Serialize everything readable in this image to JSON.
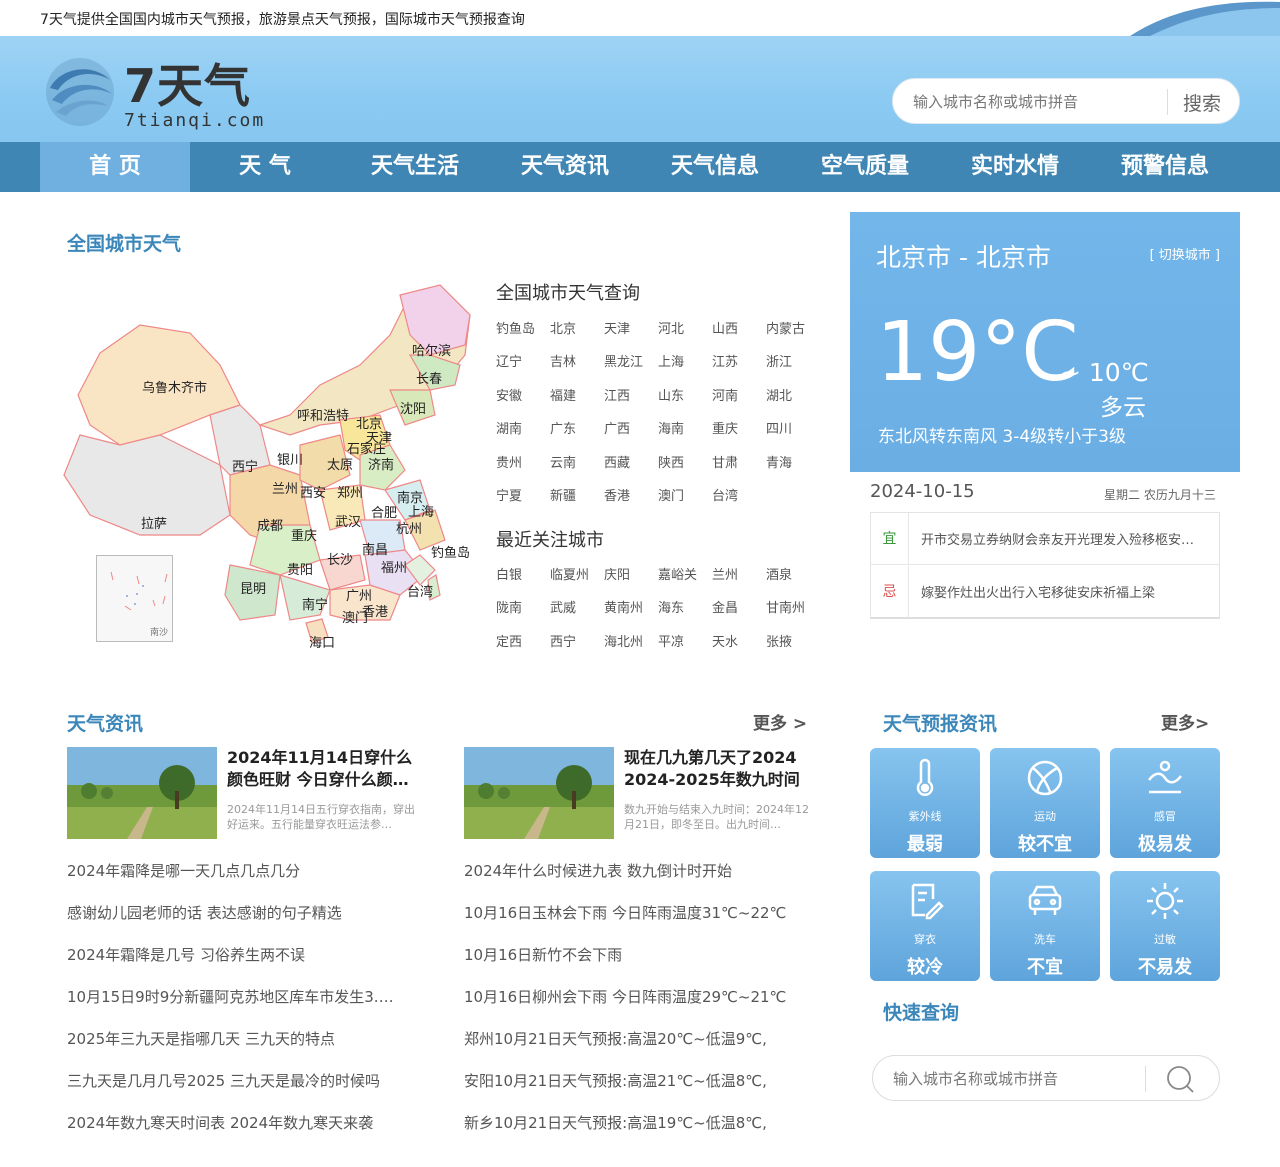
{
  "topbar": {
    "tagline": "7天气提供全国国内城市天气预报，旅游景点天气预报，国际城市天气预报查询"
  },
  "logo": {
    "wordmark": "7天气",
    "domain": "7tianqi.com"
  },
  "search_top": {
    "placeholder": "输入城市名称或城市拼音",
    "button": "搜索"
  },
  "nav": [
    "首 页",
    "天 气",
    "天气生活",
    "天气资讯",
    "天气信息",
    "空气质量",
    "实时水情",
    "预警信息"
  ],
  "national": {
    "title": "全国城市天气",
    "map_labels": [
      "乌鲁木齐市",
      "呼和浩特",
      "哈尔滨",
      "长春",
      "沈阳",
      "北京",
      "天津",
      "石家庄",
      "太原",
      "济南",
      "银川",
      "西宁",
      "兰州",
      "西安",
      "郑州",
      "南京",
      "上海",
      "合肥",
      "杭州",
      "拉萨",
      "成都",
      "重庆",
      "武汉",
      "长沙",
      "南昌",
      "福州",
      "台湾",
      "钓鱼岛",
      "贵阳",
      "昆明",
      "南宁",
      "广州",
      "香港",
      "澳门",
      "海口"
    ],
    "inset_label": "南沙",
    "query_title": "全国城市天气查询",
    "provinces": [
      "钓鱼岛",
      "北京",
      "天津",
      "河北",
      "山西",
      "内蒙古",
      "辽宁",
      "吉林",
      "黑龙江",
      "上海",
      "江苏",
      "浙江",
      "安徽",
      "福建",
      "江西",
      "山东",
      "河南",
      "湖北",
      "湖南",
      "广东",
      "广西",
      "海南",
      "重庆",
      "四川",
      "贵州",
      "云南",
      "西藏",
      "陕西",
      "甘肃",
      "青海",
      "宁夏",
      "新疆",
      "香港",
      "澳门",
      "台湾"
    ],
    "recent_title": "最近关注城市",
    "recent": [
      "白银",
      "临夏州",
      "庆阳",
      "嘉峪关",
      "兰州",
      "酒泉",
      "陇南",
      "武威",
      "黄南州",
      "海东",
      "金昌",
      "甘南州",
      "定西",
      "西宁",
      "海北州",
      "平凉",
      "天水",
      "张掖"
    ]
  },
  "weather": {
    "city": "北京市 - 北京市",
    "switch": "[ 切换城市 ]",
    "temp": "19°C",
    "low": "~ 10℃",
    "condition": "多云",
    "wind": "东北风转东南风  3-4级转小于3级",
    "date": "2024-10-15",
    "lunar": "星期二  农历九月十三",
    "yi_tag": "宜",
    "yi": "开市交易立券纳财会亲友开光理发入殓移柩安…",
    "ji_tag": "忌",
    "ji": "嫁娶作灶出火出行入宅移徙安床祈福上梁",
    "yi_color": "#3a9a3a",
    "ji_color": "#d9534f"
  },
  "news": {
    "title": "天气资讯",
    "more": "更多 >",
    "cards": [
      {
        "title": "2024年11月14日穿什么颜色旺财 今日穿什么颜…",
        "desc": "2024年11月14日五行穿衣指南，穿出好运来。五行能量穿衣旺运法参…"
      },
      {
        "title": "现在几九第几天了2024 2024-2025年数九时间表",
        "desc": "数九开始与结束入九时间：2024年12月21日，即冬至日。出九时间…"
      }
    ],
    "left": [
      "2024年霜降是哪一天几点几点几分",
      "感谢幼儿园老师的话 表达感谢的句子精选",
      "2024年霜降是几号 习俗养生两不误",
      "10月15日9时9分新疆阿克苏地区库车市发生3.…",
      "2025年三九天是指哪几天 三九天的特点",
      "三九天是几月几号2025 三九天是最冷的时候吗",
      "2024年数九寒天时间表 2024年数九寒天来袭"
    ],
    "right": [
      "2024年什么时候进九表 数九倒计时开始",
      "10月16日玉林会下雨 今日阵雨温度31℃~22℃",
      "10月16日新竹不会下雨",
      "10月16日柳州会下雨 今日阵雨温度29℃~21℃",
      "郑州10月21日天气预报:高温20℃~低温9℃,",
      "安阳10月21日天气预报:高温21℃~低温8℃,",
      "新乡10月21日天气预报:高温19℃~低温8℃,"
    ]
  },
  "forecast": {
    "title": "天气预报资讯",
    "more": "更多>",
    "tiles": [
      {
        "icon": "thermometer-icon",
        "name": "紫外线",
        "value": "最弱"
      },
      {
        "icon": "ball-icon",
        "name": "运动",
        "value": "较不宜"
      },
      {
        "icon": "fever-icon",
        "name": "感冒",
        "value": "极易发"
      },
      {
        "icon": "clothing-icon",
        "name": "穿衣",
        "value": "较冷"
      },
      {
        "icon": "car-icon",
        "name": "洗车",
        "value": "不宜"
      },
      {
        "icon": "sun-icon",
        "name": "过敏",
        "value": "不易发"
      }
    ]
  },
  "quick": {
    "title": "快速查询",
    "placeholder": "输入城市名称或城市拼音"
  },
  "colors": {
    "nav": "#3f86b4",
    "accent": "#3b87ba",
    "card": "#6aaee4"
  }
}
